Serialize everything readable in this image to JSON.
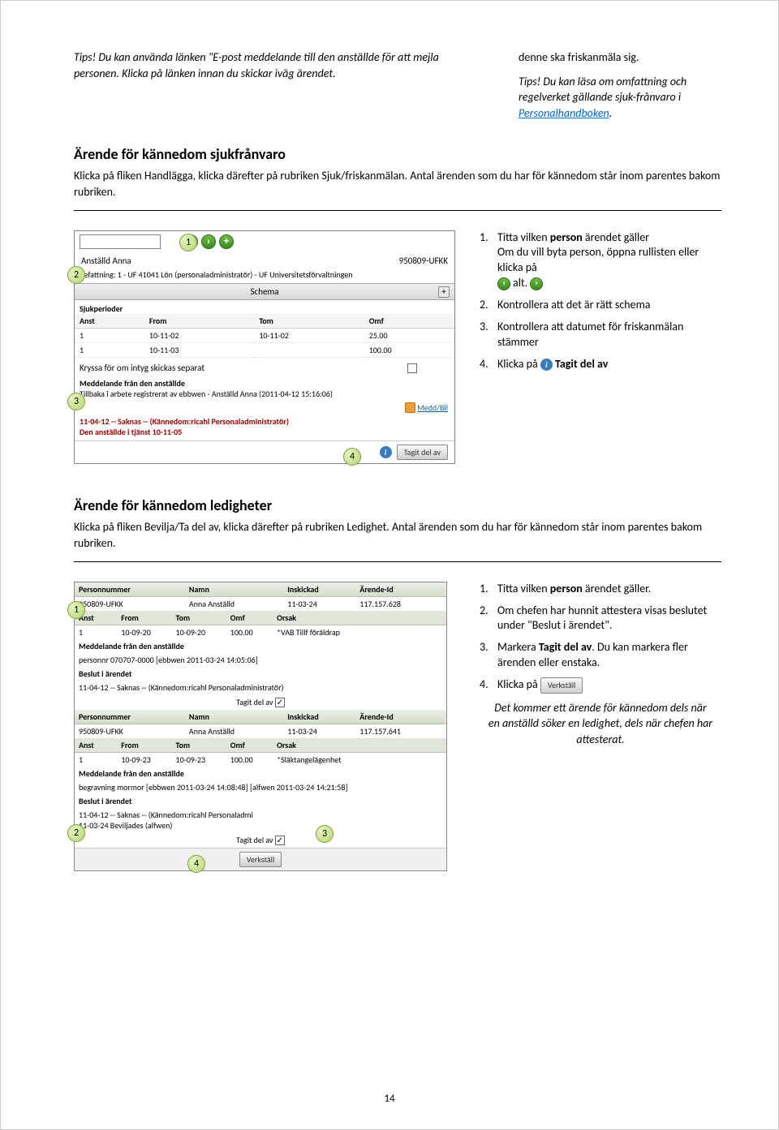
{
  "intro": {
    "left": "Tips! Du kan använda länken \"E-post meddelande till den anställde för att mejla personen. Klicka på länken innan du skickar iväg ärendet.",
    "right1": "denne ska friskanmäla sig.",
    "right2_prefix": "Tips! Du kan läsa om omfattning och regelverket gällande sjuk-frånvaro i ",
    "right2_link": "Personalhandboken",
    "right2_suffix": "."
  },
  "section1": {
    "heading": "Ärende för kännedom sjukfrånvaro",
    "body": "Klicka på fliken Handlägga, klicka därefter på rubriken Sjuk/friskanmälan. Antal ärenden som du har för kännedom står inom parentes bakom rubriken."
  },
  "panel1": {
    "name_label": "Anställd Anna",
    "id": "950809-UFKK",
    "befattning": "Befattning: 1 - UF 41041 Lön (personaladministratör) - UF Universitetsförvaltningen",
    "schema": "Schema",
    "table_head": [
      "Anst",
      "From",
      "Tom",
      "Omf"
    ],
    "rows": [
      [
        "1",
        "10-11-02",
        "10-11-02",
        "25.00"
      ],
      [
        "1",
        "10-11-03",
        "",
        "100.00"
      ]
    ],
    "sjukperioder": "Sjukperioder",
    "kryss": "Kryssa för om intyg skickas separat",
    "medd_label": "Meddelande från den anställde",
    "tillbaka": "Tillbaka i arbete registrerat av ebbwen - Anställd Anna (2011-04-12 15:16:06)",
    "meddbil": "Medd/Bil",
    "red1": "11-04-12 -- Saknas -- (Kännedom:ricahl Personaladministratör)",
    "red2": "Den anställde i tjänst 10-11-05",
    "tagit": "Tagit del av"
  },
  "steps1": {
    "s1a": "Titta vilken ",
    "s1b": "person",
    "s1c": " ärendet gäller",
    "s1d": "Om du vill byta person, öppna rullisten eller klicka på",
    "s1e": " alt. ",
    "s2": "Kontrollera att det är rätt schema",
    "s3": "Kontrollera att datumet för friskanmälan stämmer",
    "s4a": "Klicka på ",
    "s4b": "Tagit del av"
  },
  "section2": {
    "heading": "Ärende för kännedom ledigheter",
    "body": "Klicka på fliken Bevilja/Ta del av, klicka därefter på rubriken Ledighet. Antal ärenden som du har för kännedom står inom parentes bakom rubriken."
  },
  "leave": {
    "head1": [
      "Personnummer",
      "Namn",
      "Inskickad",
      "Ärende-Id"
    ],
    "r1": [
      "950809-UFKK",
      "Anna Anställd",
      "11-03-24",
      "117.157.628"
    ],
    "head2": [
      "Anst",
      "From",
      "Tom",
      "Omf",
      "Orsak"
    ],
    "r2": [
      "1",
      "10-09-20",
      "10-09-20",
      "100.00",
      "*VAB Tillf föräldrap"
    ],
    "medd_lbl": "Meddelande från den anställde",
    "medd1": "personnr 070707-0000 [ebbwen 2011-03-24 14:05:06]",
    "beslut_lbl": "Beslut i ärendet",
    "beslut1": "11-04-12 -- Saknas -- (Kännedom:ricahl Personaladministratör)",
    "tagit_lbl": "Tagit del av",
    "r1b": [
      "950809-UFKK",
      "Anna Anställd",
      "11-03-24",
      "117.157.641"
    ],
    "r2b": [
      "1",
      "10-09-23",
      "10-09-23",
      "100.00",
      "*Släktangelägenhet"
    ],
    "medd2": "begravning mormor [ebbwen 2011-03-24 14:08:48] [alfwen 2011-03-24 14:21:58]",
    "beslut_lbl2": "Beslut i ärendet",
    "beslut2a": "11-04-12 -- Saknas -- (Kännedom:ricahl Personaladmi",
    "beslut2b": "11-03-24 Beviljades (alfwen)",
    "verkstall": "Verkställ"
  },
  "steps2": {
    "s1a": "Titta vilken ",
    "s1b": "person",
    "s1c": " ärendet gäller.",
    "s2": "Om chefen har hunnit attestera visas beslutet under \"Beslut i ärendet\".",
    "s3a": "Markera ",
    "s3b": "Tagit del av",
    "s3c": ". Du kan markera fler ärenden eller enstaka.",
    "s4": "Klicka på ",
    "note": "Det kommer ett ärende för kännedom dels när en anställd söker en ledighet, dels när chefen har attesterat."
  },
  "verkstall_btn": "Verkställ",
  "page_num": "14",
  "markers": {
    "m1": "1",
    "m2": "2",
    "m3": "3",
    "m4": "4"
  }
}
